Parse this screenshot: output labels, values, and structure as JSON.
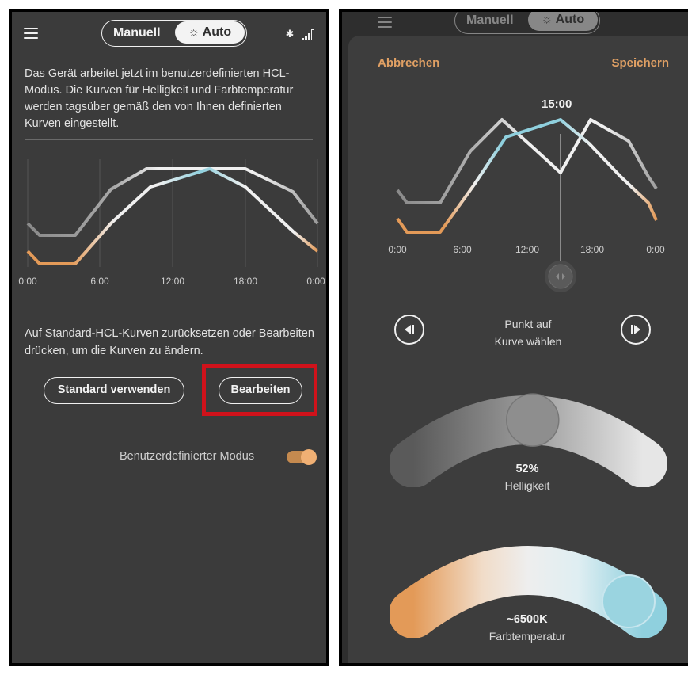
{
  "left_screen": {
    "mode_switch": {
      "manual_label": "Manuell",
      "auto_label": "Auto",
      "selected": "Auto"
    },
    "description": "Das Gerät arbeitet jetzt im benutzerdefinierten HCL-Modus. Die Kurven für Helligkeit und Farbtemperatur werden tagsüber gemäß den von Ihnen definierten Kurven eingestellt.",
    "chart": {
      "x_ticks": [
        "0:00",
        "6:00",
        "12:00",
        "18:00",
        "0:00"
      ]
    },
    "reset_text": "Auf Standard-HCL-Kurven zurücksetzen oder Bearbeiten drücken, um die Kurven zu ändern.",
    "standard_button": "Standard verwenden",
    "edit_button": "Bearbeiten",
    "custom_mode_label": "Benutzerdefinierter Modus",
    "custom_mode_on": true
  },
  "right_screen": {
    "cancel_label": "Abbrechen",
    "save_label": "Speichern",
    "selected_time": "15:00",
    "chart": {
      "x_ticks": [
        "0:00",
        "6:00",
        "12:00",
        "18:00",
        "0:00"
      ]
    },
    "pick_point_text": [
      "Punkt auf",
      "Kurve wählen"
    ],
    "brightness": {
      "value": "52%",
      "label": "Helligkeit",
      "level": 0.52
    },
    "color_temperature": {
      "value": "~6500K",
      "label": "Farbtemperatur"
    }
  },
  "colors": {
    "accent": "#e0a064",
    "highlight": "#d0121b",
    "warm": "#e39a58",
    "cool": "#8fd0de"
  }
}
